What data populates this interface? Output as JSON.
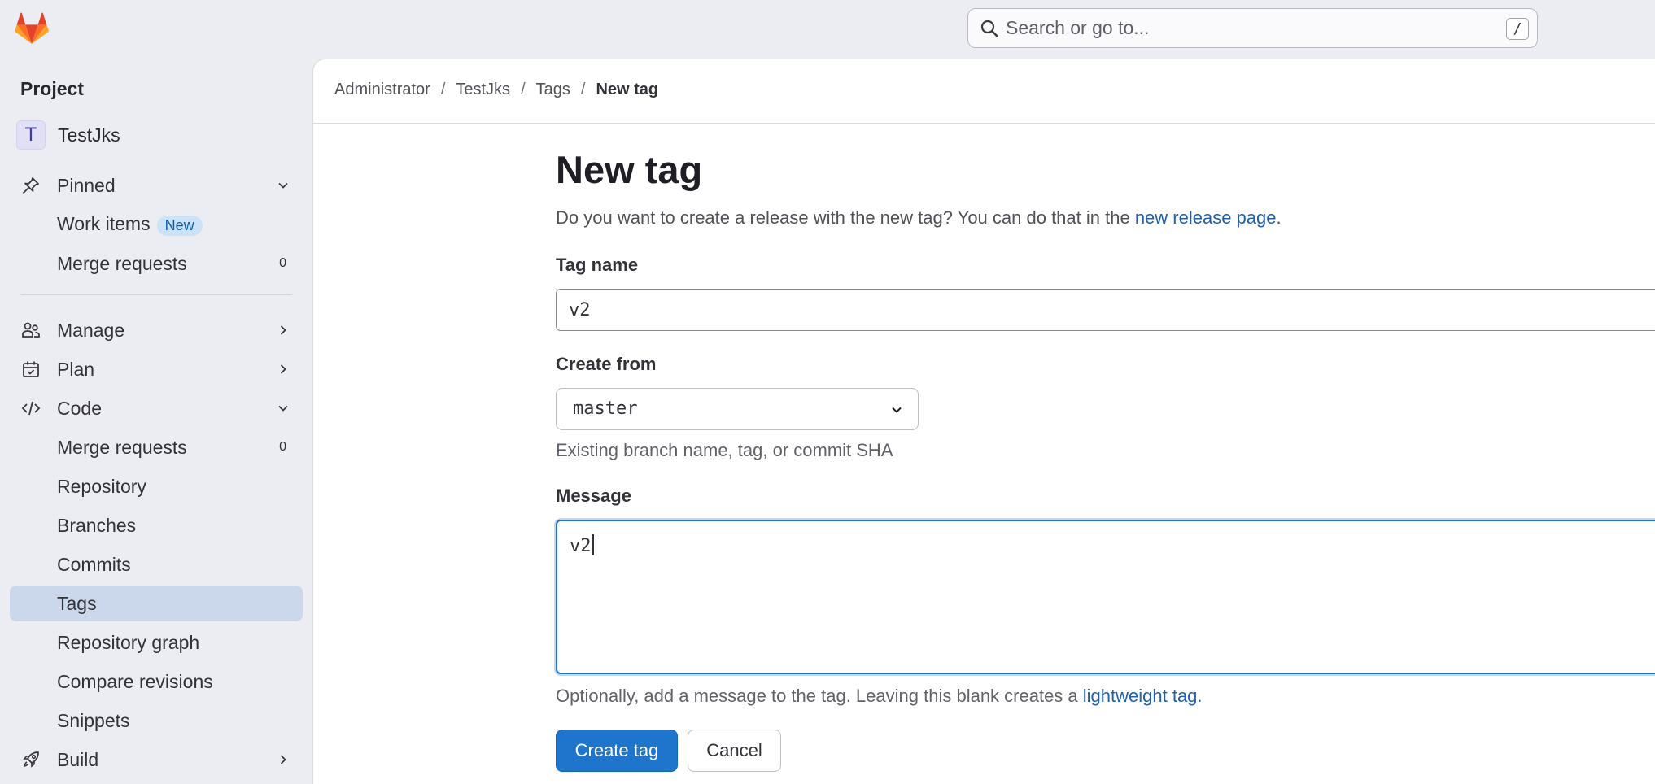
{
  "colors": {
    "primary": "#1f75cb",
    "link": "#1f5fae",
    "active_nav": "#cbd8ec",
    "badge_bg": "#cbe2f9",
    "sidebar_bg": "#ececf3"
  },
  "search": {
    "placeholder": "Search or go to...",
    "shortcut": "/",
    "icon": "search-icon"
  },
  "sidebar": {
    "heading": "Project",
    "project": {
      "avatar": "T",
      "name": "TestJks"
    },
    "pinned": {
      "label": "Pinned",
      "icon": "pin-icon"
    },
    "pinned_items": [
      {
        "label": "Work items",
        "badge": "New"
      },
      {
        "label": "Merge requests",
        "count": "0"
      }
    ],
    "sections": [
      {
        "label": "Manage",
        "icon": "users-icon"
      },
      {
        "label": "Plan",
        "icon": "calendar-icon"
      },
      {
        "label": "Code",
        "icon": "code-icon"
      }
    ],
    "code_items": [
      {
        "label": "Merge requests",
        "count": "0"
      },
      {
        "label": "Repository"
      },
      {
        "label": "Branches"
      },
      {
        "label": "Commits"
      },
      {
        "label": "Tags"
      },
      {
        "label": "Repository graph"
      },
      {
        "label": "Compare revisions"
      },
      {
        "label": "Snippets"
      }
    ],
    "build": {
      "label": "Build",
      "icon": "rocket-icon"
    }
  },
  "breadcrumb": {
    "items": [
      "Administrator",
      "TestJks",
      "Tags"
    ],
    "current": "New tag",
    "separator": "/"
  },
  "page": {
    "title": "New tag",
    "intro": "Do you want to create a release with the new tag? You can do that in the ",
    "intro_link": "new release page",
    "intro_end": "."
  },
  "form": {
    "tag_name_label": "Tag name",
    "tag_name_value": "v2",
    "create_from_label": "Create from",
    "create_from_value": "master",
    "create_from_help": "Existing branch name, tag, or commit SHA",
    "message_label": "Message",
    "message_value": "v2",
    "message_help": "Optionally, add a message to the tag. Leaving this blank creates a ",
    "message_help_link": "lightweight tag",
    "message_help_end": ".",
    "submit_label": "Create tag",
    "cancel_label": "Cancel"
  }
}
